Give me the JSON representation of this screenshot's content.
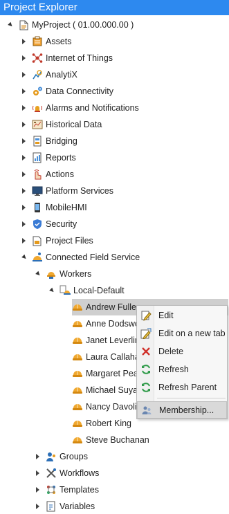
{
  "window": {
    "title": "Project Explorer"
  },
  "tree": {
    "root": {
      "label": "MyProject ( 01.00.000.00 )"
    },
    "items": [
      {
        "label": "Assets"
      },
      {
        "label": "Internet of Things"
      },
      {
        "label": "AnalytiX"
      },
      {
        "label": "Data Connectivity"
      },
      {
        "label": "Alarms and Notifications"
      },
      {
        "label": "Historical Data"
      },
      {
        "label": "Bridging"
      },
      {
        "label": "Reports"
      },
      {
        "label": "Actions"
      },
      {
        "label": "Platform Services"
      },
      {
        "label": "MobileHMI"
      },
      {
        "label": "Security"
      },
      {
        "label": "Project Files"
      },
      {
        "label": "Connected Field Service"
      }
    ],
    "cfs": {
      "workers": {
        "label": "Workers"
      },
      "local_default": {
        "label": "Local-Default"
      },
      "people": [
        {
          "label": "Andrew Fulle"
        },
        {
          "label": "Anne Dodswo"
        },
        {
          "label": "Janet Leverlin"
        },
        {
          "label": "Laura Callaha"
        },
        {
          "label": "Margaret Pea"
        },
        {
          "label": "Michael Suya"
        },
        {
          "label": "Nancy Davoli"
        },
        {
          "label": "Robert King"
        },
        {
          "label": "Steve Buchanan"
        }
      ],
      "groups": {
        "label": "Groups"
      },
      "workflows": {
        "label": "Workflows"
      },
      "templates": {
        "label": "Templates"
      },
      "variables": {
        "label": "Variables"
      }
    }
  },
  "context_menu": {
    "items": [
      {
        "label": "Edit",
        "icon": "edit-icon"
      },
      {
        "label": "Edit on a new tab",
        "icon": "edit-new-tab-icon"
      },
      {
        "label": "Delete",
        "icon": "delete-icon"
      },
      {
        "label": "Refresh",
        "icon": "refresh-icon"
      },
      {
        "label": "Refresh Parent",
        "icon": "refresh-parent-icon"
      },
      {
        "label": "Membership...",
        "icon": "membership-icon"
      }
    ]
  },
  "colors": {
    "title_bar": "#2d89ef",
    "selection": "#cfcfcf",
    "menu_highlight": "#d9d9d9"
  }
}
